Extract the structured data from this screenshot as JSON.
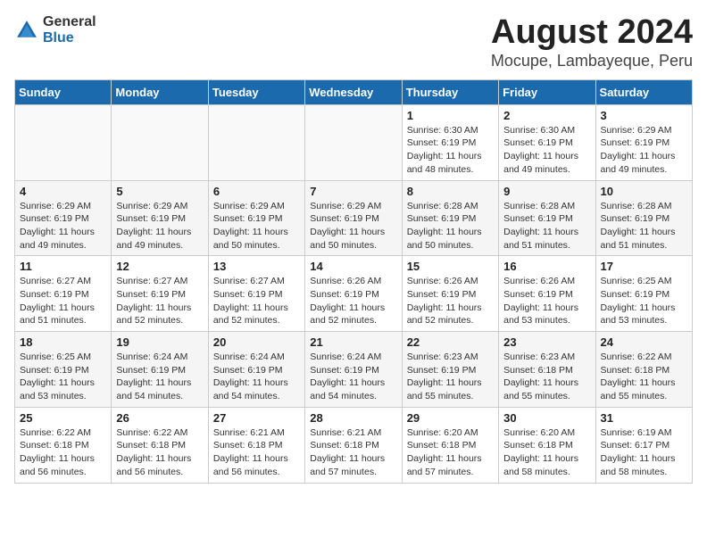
{
  "header": {
    "logo_general": "General",
    "logo_blue": "Blue",
    "title": "August 2024",
    "subtitle": "Mocupe, Lambayeque, Peru"
  },
  "days_of_week": [
    "Sunday",
    "Monday",
    "Tuesday",
    "Wednesday",
    "Thursday",
    "Friday",
    "Saturday"
  ],
  "weeks": [
    [
      {
        "day": "",
        "detail": ""
      },
      {
        "day": "",
        "detail": ""
      },
      {
        "day": "",
        "detail": ""
      },
      {
        "day": "",
        "detail": ""
      },
      {
        "day": "1",
        "detail": "Sunrise: 6:30 AM\nSunset: 6:19 PM\nDaylight: 11 hours\nand 48 minutes."
      },
      {
        "day": "2",
        "detail": "Sunrise: 6:30 AM\nSunset: 6:19 PM\nDaylight: 11 hours\nand 49 minutes."
      },
      {
        "day": "3",
        "detail": "Sunrise: 6:29 AM\nSunset: 6:19 PM\nDaylight: 11 hours\nand 49 minutes."
      }
    ],
    [
      {
        "day": "4",
        "detail": "Sunrise: 6:29 AM\nSunset: 6:19 PM\nDaylight: 11 hours\nand 49 minutes."
      },
      {
        "day": "5",
        "detail": "Sunrise: 6:29 AM\nSunset: 6:19 PM\nDaylight: 11 hours\nand 49 minutes."
      },
      {
        "day": "6",
        "detail": "Sunrise: 6:29 AM\nSunset: 6:19 PM\nDaylight: 11 hours\nand 50 minutes."
      },
      {
        "day": "7",
        "detail": "Sunrise: 6:29 AM\nSunset: 6:19 PM\nDaylight: 11 hours\nand 50 minutes."
      },
      {
        "day": "8",
        "detail": "Sunrise: 6:28 AM\nSunset: 6:19 PM\nDaylight: 11 hours\nand 50 minutes."
      },
      {
        "day": "9",
        "detail": "Sunrise: 6:28 AM\nSunset: 6:19 PM\nDaylight: 11 hours\nand 51 minutes."
      },
      {
        "day": "10",
        "detail": "Sunrise: 6:28 AM\nSunset: 6:19 PM\nDaylight: 11 hours\nand 51 minutes."
      }
    ],
    [
      {
        "day": "11",
        "detail": "Sunrise: 6:27 AM\nSunset: 6:19 PM\nDaylight: 11 hours\nand 51 minutes."
      },
      {
        "day": "12",
        "detail": "Sunrise: 6:27 AM\nSunset: 6:19 PM\nDaylight: 11 hours\nand 52 minutes."
      },
      {
        "day": "13",
        "detail": "Sunrise: 6:27 AM\nSunset: 6:19 PM\nDaylight: 11 hours\nand 52 minutes."
      },
      {
        "day": "14",
        "detail": "Sunrise: 6:26 AM\nSunset: 6:19 PM\nDaylight: 11 hours\nand 52 minutes."
      },
      {
        "day": "15",
        "detail": "Sunrise: 6:26 AM\nSunset: 6:19 PM\nDaylight: 11 hours\nand 52 minutes."
      },
      {
        "day": "16",
        "detail": "Sunrise: 6:26 AM\nSunset: 6:19 PM\nDaylight: 11 hours\nand 53 minutes."
      },
      {
        "day": "17",
        "detail": "Sunrise: 6:25 AM\nSunset: 6:19 PM\nDaylight: 11 hours\nand 53 minutes."
      }
    ],
    [
      {
        "day": "18",
        "detail": "Sunrise: 6:25 AM\nSunset: 6:19 PM\nDaylight: 11 hours\nand 53 minutes."
      },
      {
        "day": "19",
        "detail": "Sunrise: 6:24 AM\nSunset: 6:19 PM\nDaylight: 11 hours\nand 54 minutes."
      },
      {
        "day": "20",
        "detail": "Sunrise: 6:24 AM\nSunset: 6:19 PM\nDaylight: 11 hours\nand 54 minutes."
      },
      {
        "day": "21",
        "detail": "Sunrise: 6:24 AM\nSunset: 6:19 PM\nDaylight: 11 hours\nand 54 minutes."
      },
      {
        "day": "22",
        "detail": "Sunrise: 6:23 AM\nSunset: 6:19 PM\nDaylight: 11 hours\nand 55 minutes."
      },
      {
        "day": "23",
        "detail": "Sunrise: 6:23 AM\nSunset: 6:18 PM\nDaylight: 11 hours\nand 55 minutes."
      },
      {
        "day": "24",
        "detail": "Sunrise: 6:22 AM\nSunset: 6:18 PM\nDaylight: 11 hours\nand 55 minutes."
      }
    ],
    [
      {
        "day": "25",
        "detail": "Sunrise: 6:22 AM\nSunset: 6:18 PM\nDaylight: 11 hours\nand 56 minutes."
      },
      {
        "day": "26",
        "detail": "Sunrise: 6:22 AM\nSunset: 6:18 PM\nDaylight: 11 hours\nand 56 minutes."
      },
      {
        "day": "27",
        "detail": "Sunrise: 6:21 AM\nSunset: 6:18 PM\nDaylight: 11 hours\nand 56 minutes."
      },
      {
        "day": "28",
        "detail": "Sunrise: 6:21 AM\nSunset: 6:18 PM\nDaylight: 11 hours\nand 57 minutes."
      },
      {
        "day": "29",
        "detail": "Sunrise: 6:20 AM\nSunset: 6:18 PM\nDaylight: 11 hours\nand 57 minutes."
      },
      {
        "day": "30",
        "detail": "Sunrise: 6:20 AM\nSunset: 6:18 PM\nDaylight: 11 hours\nand 58 minutes."
      },
      {
        "day": "31",
        "detail": "Sunrise: 6:19 AM\nSunset: 6:17 PM\nDaylight: 11 hours\nand 58 minutes."
      }
    ]
  ]
}
